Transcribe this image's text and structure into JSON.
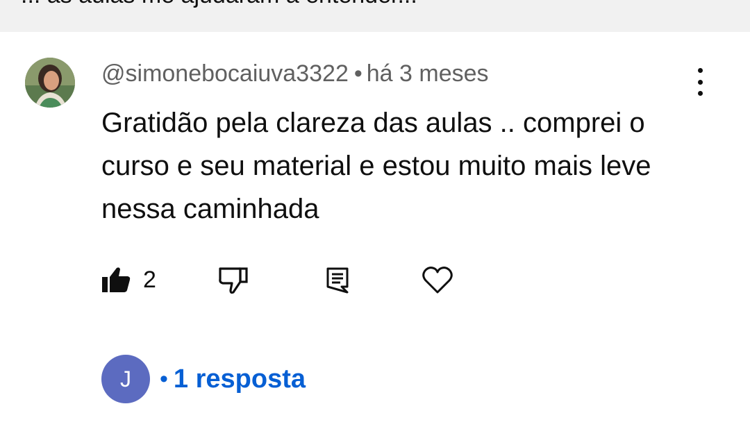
{
  "top_strip": {
    "partial_text": "... as aulas me ajudaram a entender..."
  },
  "comment": {
    "author": "@simonebocaiuva3322",
    "separator": "•",
    "time": "há 3 meses",
    "text": "Gratidão pela clareza das aulas .. comprei o curso e seu material e estou muito mais leve nessa caminhada",
    "avatar_icon": "user-photo-avatar"
  },
  "actions": {
    "like_icon": "thumbs-up-filled-icon",
    "like_count": "2",
    "dislike_icon": "thumbs-down-outline-icon",
    "reply_icon": "comment-reply-icon",
    "heart_icon": "heart-outline-icon"
  },
  "menu": {
    "icon": "more-vertical-icon"
  },
  "replies": {
    "avatar_letter": "J",
    "separator": "•",
    "label": "1 resposta",
    "avatar_color": "#5c6bc0",
    "link_color": "#065fd4"
  }
}
